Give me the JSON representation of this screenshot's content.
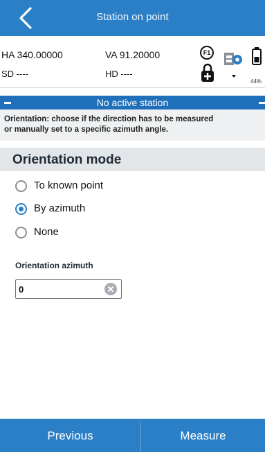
{
  "header": {
    "title": "Station on point",
    "back_icon": "chevron-left-icon"
  },
  "status": {
    "ha": "HA 340.00000",
    "va": "VA 91.20000",
    "sd": "SD ----",
    "hd": "HD ----",
    "f1_label": "F1",
    "battery_percent": "44%"
  },
  "banner": {
    "text": "No active station"
  },
  "help": {
    "line1": "Orientation: choose if the direction has to be measured",
    "line2": "or manually set to a specific azimuth angle."
  },
  "section": {
    "title": "Orientation mode"
  },
  "options": [
    {
      "label": "To known point",
      "selected": false
    },
    {
      "label": "By azimuth",
      "selected": true
    },
    {
      "label": "None",
      "selected": false
    }
  ],
  "azimuth": {
    "label": "Orientation azimuth",
    "value": "0"
  },
  "footer": {
    "previous_label": "Previous",
    "measure_label": "Measure"
  },
  "colors": {
    "accent": "#2b7fc6",
    "banner": "#1f6fba",
    "section_bg": "#e3e6e9"
  }
}
